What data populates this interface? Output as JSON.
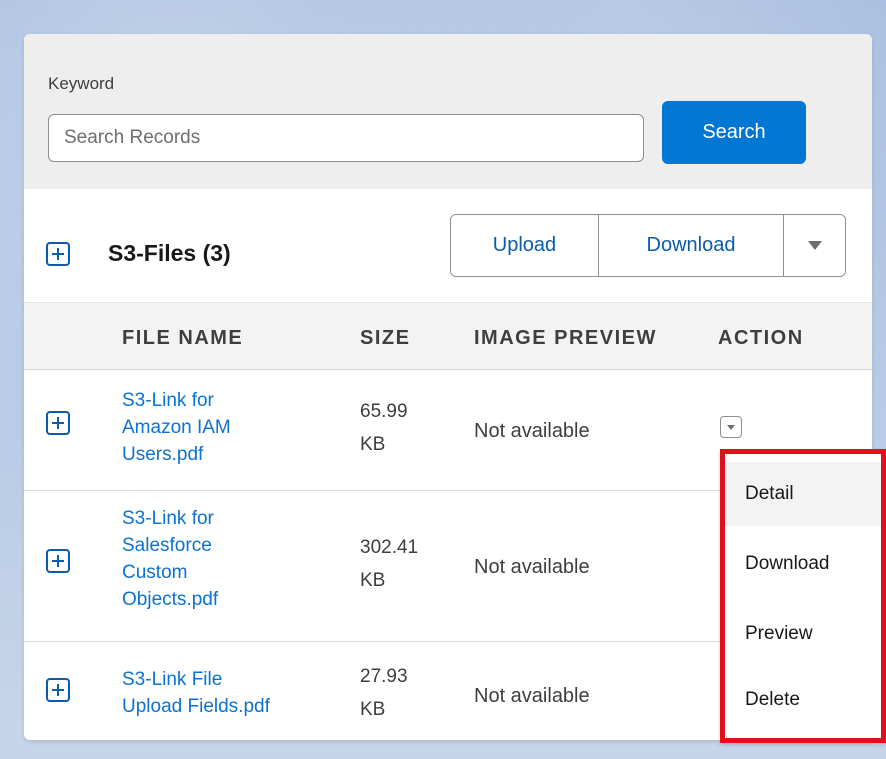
{
  "search": {
    "keyword_label": "Keyword",
    "placeholder": "Search Records",
    "value": "",
    "button_label": "Search"
  },
  "files": {
    "title": "S3-Files (3)",
    "upload_label": "Upload",
    "download_label": "Download"
  },
  "table": {
    "headers": {
      "file_name": "FILE NAME",
      "size": "SIZE",
      "image_preview": "IMAGE PREVIEW",
      "action": "ACTION"
    },
    "rows": [
      {
        "name_lines": [
          "S3-Link for",
          "Amazon IAM",
          "Users.pdf"
        ],
        "size_lines": [
          "65.99",
          "KB"
        ],
        "preview": "Not available"
      },
      {
        "name_lines": [
          "S3-Link for",
          "Salesforce",
          "Custom",
          "Objects.pdf"
        ],
        "size_lines": [
          "302.41",
          "KB"
        ],
        "preview": "Not available"
      },
      {
        "name_lines": [
          "S3-Link File",
          "Upload Fields.pdf"
        ],
        "size_lines": [
          "27.93",
          "KB"
        ],
        "preview": "Not available"
      }
    ]
  },
  "action_menu": {
    "items": [
      "Detail",
      "Download",
      "Preview",
      "Delete"
    ],
    "highlight_color": "#e3101b"
  },
  "colors": {
    "brand_blue": "#0176d3",
    "link_blue": "#0b72d3"
  }
}
